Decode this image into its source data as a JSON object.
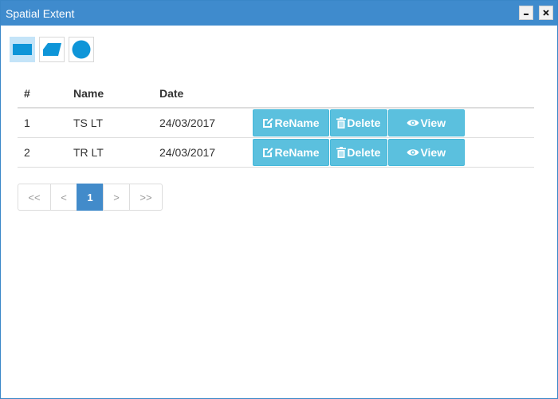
{
  "window": {
    "title": "Spatial Extent"
  },
  "colors": {
    "titlebar": "#3f8bcd",
    "action_button": "#5bc0de",
    "tool_icon": "#0e95d8",
    "active_page": "#428bca"
  },
  "tools": [
    {
      "icon": "rectangle-icon",
      "active": true
    },
    {
      "icon": "polygon-icon",
      "active": false
    },
    {
      "icon": "circle-icon",
      "active": false
    }
  ],
  "table": {
    "headers": [
      "#",
      "Name",
      "Date"
    ],
    "rows": [
      {
        "num": "1",
        "name": "TS LT",
        "date": "24/03/2017"
      },
      {
        "num": "2",
        "name": "TR LT",
        "date": "24/03/2017"
      }
    ],
    "actions": {
      "rename": "ReName",
      "delete": "Delete",
      "view": "View"
    }
  },
  "pagination": {
    "first": "<<",
    "prev": "<",
    "current": "1",
    "next": ">",
    "last": ">>"
  }
}
